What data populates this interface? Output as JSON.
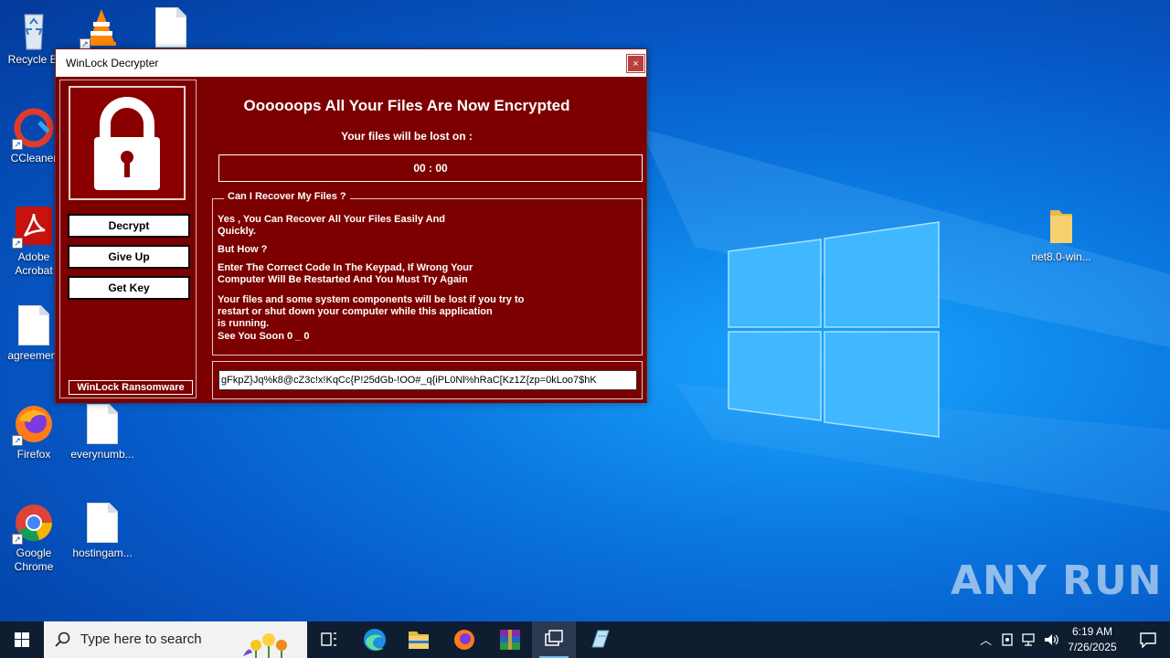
{
  "desktop": {
    "icons": [
      {
        "label": "Recycle Bin",
        "display": "Recycle Bi"
      },
      {
        "label": ""
      },
      {
        "label": ""
      },
      {
        "label": "CCleaner"
      },
      {
        "label": "Adobe Acrobat",
        "display": "Adobe\nAcrobat"
      },
      {
        "label": "agreement"
      },
      {
        "label": "Firefox"
      },
      {
        "label": "everynumb..."
      },
      {
        "label": "Google Chrome",
        "display": "Google\nChrome"
      },
      {
        "label": "hostingam..."
      },
      {
        "label": "net8.0-win..."
      }
    ]
  },
  "window": {
    "title": "WinLock Decrypter",
    "close_label": "×",
    "headline": "Oooooops All Your Files Are Now Encrypted",
    "lost_label": "Your files will be lost on :",
    "timer": "00 : 00",
    "buttons": {
      "decrypt": "Decrypt",
      "give_up": "Give Up",
      "get_key": "Get Key"
    },
    "brand": "WinLock Ransomware",
    "recover_legend": "Can I Recover My Files ?",
    "msg1": "Yes , You Can Recover All Your Files Easily And\nQuickly.",
    "msg2": "But How ?",
    "msg3": "Enter The Correct Code In The Keypad, If Wrong Your\nComputer Will Be Restarted And You Must Try Again",
    "msg4": "Your files and some system components will be lost if you try to\nrestart or shut down your computer while this application\n is running.",
    "msg5": "See You Soon 0 _ 0",
    "key_value": "gFkpZ}Jq%k8@cZ3c!x!KqCc{P!25dGb-!OO#_q{iPL0Nl%hRaC[Kz1Z{zp=0kLoo7$hK"
  },
  "taskbar": {
    "search_placeholder": "Type here to search",
    "time": "6:19 AM",
    "date": "7/26/2025",
    "apps": [
      "task-view",
      "edge",
      "file-explorer",
      "firefox",
      "winrar",
      "winlock",
      "notepad"
    ]
  },
  "watermark": "ANY RUN",
  "colors": {
    "window_red": "#7c0000",
    "taskbar": "#0f1d30",
    "desktop_blue": "#0a78e0"
  }
}
